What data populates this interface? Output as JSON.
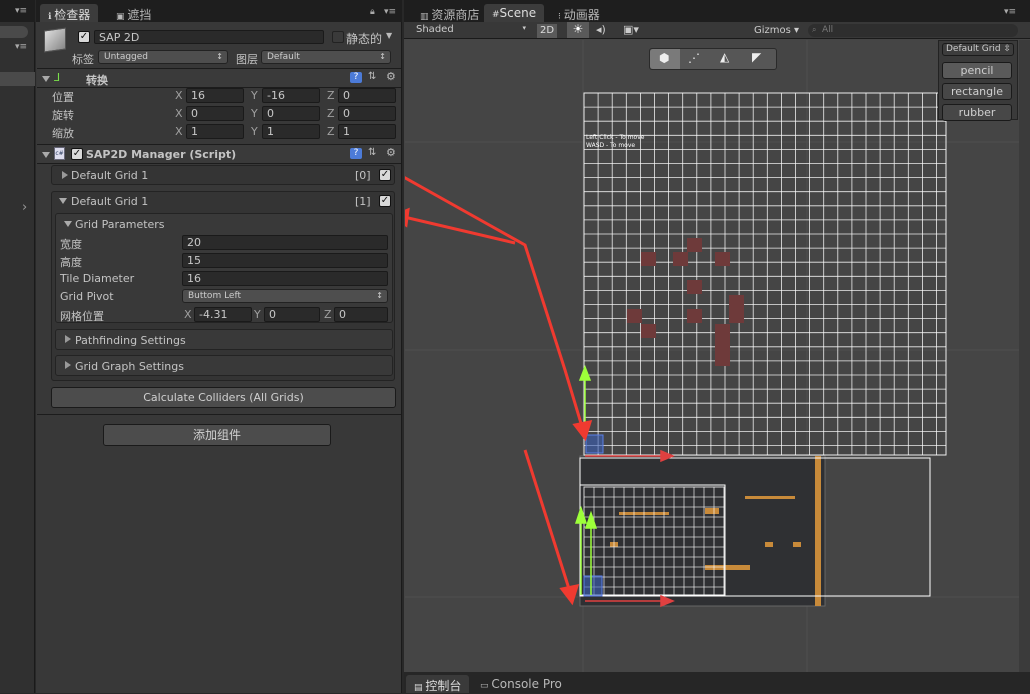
{
  "tabs": {
    "inspector": "检查器",
    "occlusion": "遮挡",
    "asset_store": "资源商店",
    "scene": "Scene",
    "animator": "动画器",
    "console": "控制台",
    "console_pro": "Console Pro"
  },
  "inspector": {
    "object_name": "SAP 2D",
    "static_label": "静态的",
    "tag_label": "标签",
    "tag_value": "Untagged",
    "layer_label": "图层",
    "layer_value": "Default",
    "transform": {
      "title": "转换",
      "position_label": "位置",
      "rotation_label": "旋转",
      "scale_label": "缩放",
      "axis_x": "X",
      "axis_y": "Y",
      "axis_z": "Z",
      "position": [
        "16",
        "-16",
        "0"
      ],
      "rotation": [
        "0",
        "0",
        "0"
      ],
      "scale": [
        "1",
        "1",
        "1"
      ]
    },
    "script": {
      "title": "SAP2D Manager (Script)",
      "grid0_title": "Default Grid 1",
      "grid0_index": "[0]",
      "grid1_title": "Default Grid 1",
      "grid1_index": "[1]",
      "params_title": "Grid Parameters",
      "width_label": "宽度",
      "width_value": "20",
      "height_label": "高度",
      "height_value": "15",
      "tile_label": "Tile Diameter",
      "tile_value": "16",
      "pivot_label": "Grid Pivot",
      "pivot_value": "Buttom Left",
      "gridpos_label": "网格位置",
      "gridpos": [
        "-4.31",
        "0",
        "0"
      ],
      "pathfinding": "Pathfinding Settings",
      "graph": "Grid Graph Settings",
      "calc_button": "Calculate Colliders (All Grids)"
    },
    "add_component": "添加组件"
  },
  "scene": {
    "shading": "Shaded",
    "mode_2d": "2D",
    "gizmos": "Gizmos",
    "search_placeholder": "All",
    "overlay_text1": "Left Click - To move",
    "overlay_text2": "WASD - To move",
    "side_dropdown": "Default Grid",
    "side_buttons": [
      "pencil",
      "rectangle",
      "rubber"
    ]
  },
  "colors": {
    "arrow": "#f03a30",
    "grid_line": "#ffffff",
    "obstacle": "#7a3a3a",
    "gizmo_green": "#9dff3a"
  }
}
